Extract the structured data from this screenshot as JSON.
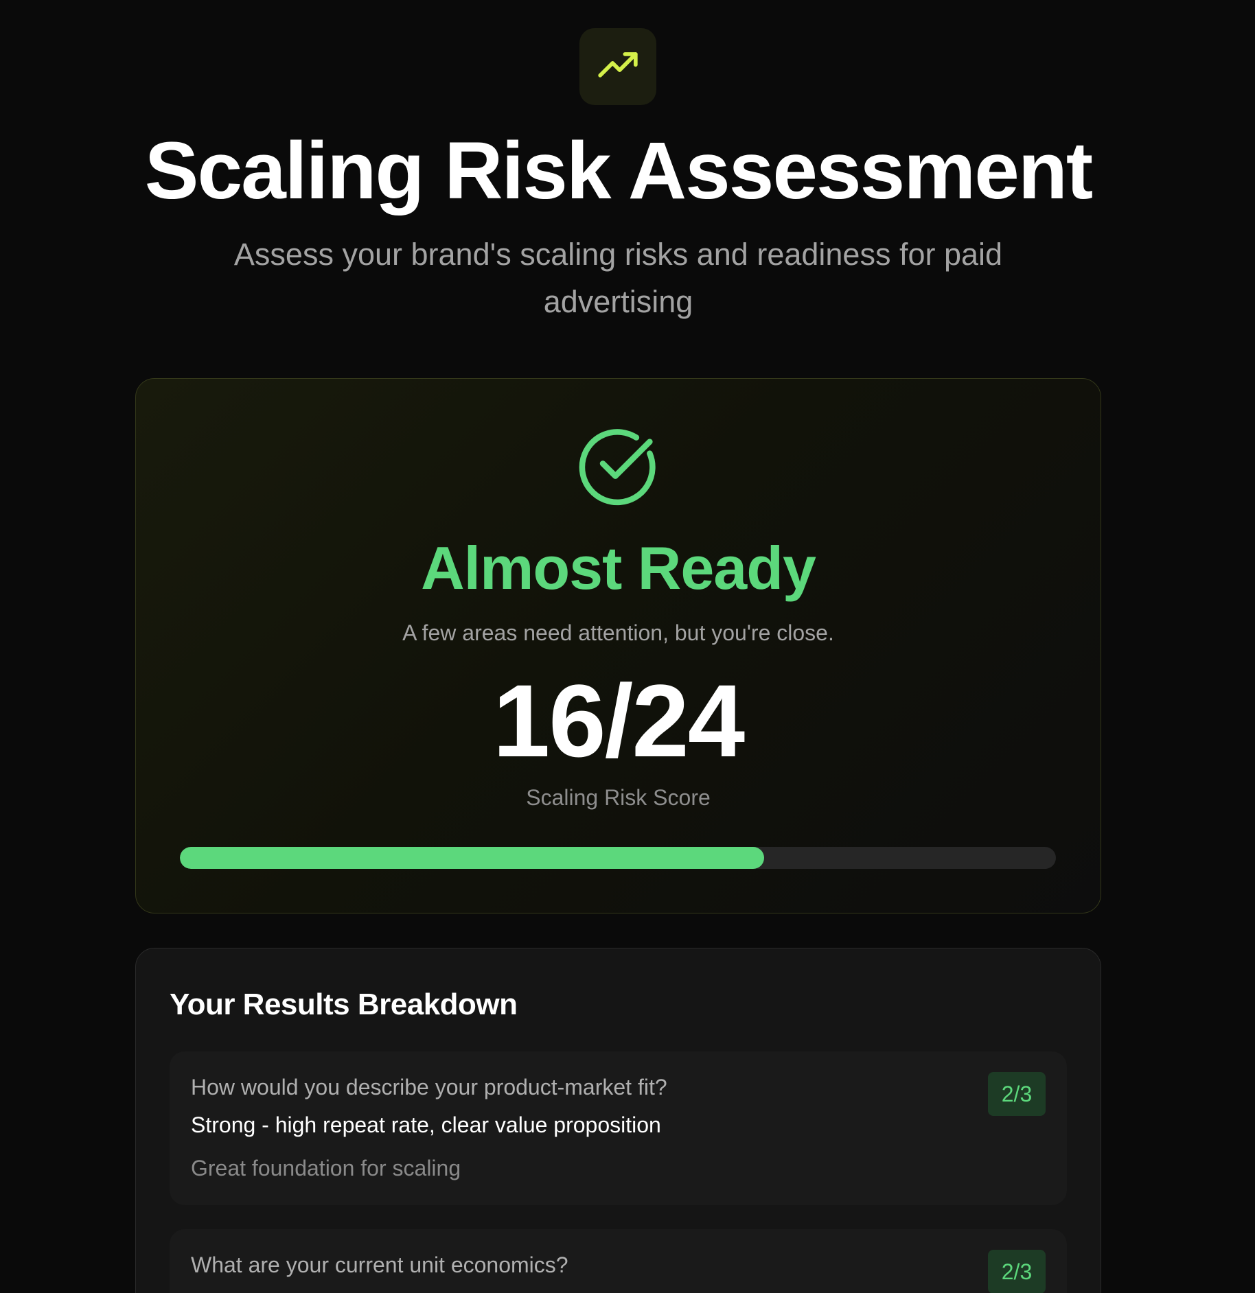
{
  "header": {
    "logo_icon": "trending-up-icon",
    "title": "Scaling Risk Assessment",
    "subtitle": "Assess your brand's scaling risks and readiness for paid advertising"
  },
  "score_card": {
    "icon": "check-circle-icon",
    "status": "Almost Ready",
    "description": "A few areas need attention, but you're close.",
    "score_text": "16/24",
    "score_label": "Scaling Risk Score",
    "score": 16,
    "max_score": 24,
    "progress_fraction": 0.667
  },
  "results": {
    "title": "Your Results Breakdown",
    "items": [
      {
        "question": "How would you describe your product-market fit?",
        "answer": "Strong - high repeat rate, clear value proposition",
        "feedback": "Great foundation for scaling",
        "score": "2/3"
      },
      {
        "question": "What are your current unit economics?",
        "score": "2/3"
      }
    ]
  },
  "colors": {
    "background": "#0a0a0a",
    "accent_green": "#5cd87c",
    "accent_lime": "#d4f04a",
    "badge_bg": "#1d3b25"
  }
}
